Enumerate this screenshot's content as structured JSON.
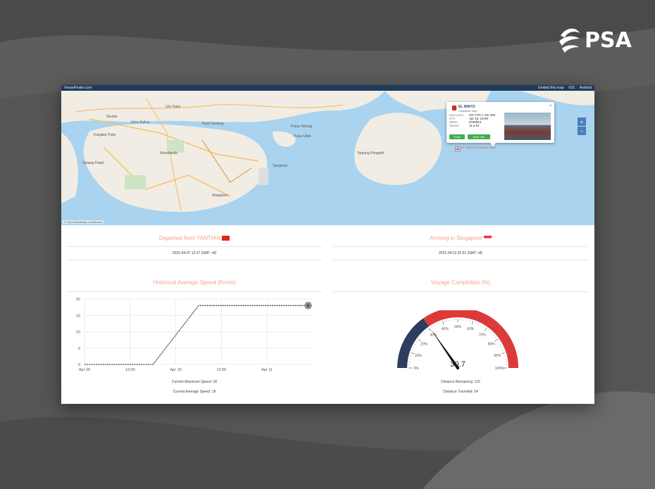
{
  "brand": {
    "logo_text": "PSA"
  },
  "site": {
    "name": "VesselFinder.com",
    "links": [
      "Embed this map",
      "iOS",
      "Android"
    ]
  },
  "map": {
    "labels": [
      {
        "text": "Johor Bahru",
        "kind": "city"
      },
      {
        "text": "Pulau Ubin",
        "kind": "city"
      },
      {
        "text": "Skudai",
        "kind": "city"
      },
      {
        "text": "Pulau Tekong",
        "kind": "city"
      },
      {
        "text": "Ulu Tiram",
        "kind": "city"
      },
      {
        "text": "Pasir Gudang",
        "kind": "city"
      },
      {
        "text": "Kangkar Pulai",
        "kind": "city"
      },
      {
        "text": "Woodlands",
        "kind": "city"
      },
      {
        "text": "Tampines",
        "kind": "city"
      },
      {
        "text": "Singapore",
        "kind": "city"
      },
      {
        "text": "Tanjung Pengelih",
        "kind": "city"
      },
      {
        "text": "Gelang Patah",
        "kind": "city"
      }
    ],
    "zoom_in": "+",
    "zoom_out": "−",
    "attribution": "© OpenStreetMap contributors"
  },
  "popup": {
    "vessel_name": "EL NINYO",
    "vessel_type": "Container Ship",
    "rows": [
      {
        "key": "Navi.point",
        "value": "CN YTN > SG SIN"
      },
      {
        "key": "ETA",
        "value": "Apr 10, 23:00"
      },
      {
        "key": "MMSI",
        "value": "9780913"
      },
      {
        "key": "Speed",
        "value": "11.2 kn"
      }
    ],
    "track_label": "Track",
    "more_info_label": "More info",
    "close": "×",
    "marker_caption": "EL NINYO (Container Ship)"
  },
  "departure": {
    "title": "Departed from YANTIAN",
    "time": "2021-04-07 12:17 (GMT +8)",
    "flag_color": "#de2910"
  },
  "arrival": {
    "title": "Arriving in Singapore",
    "time": "2021-04-11 01:51 (GMT +8)",
    "flag_color": "#ef3340"
  },
  "speed_section": {
    "title": "Historical Average Speed (Knots)",
    "max_speed": "Current Maximum Speed: 18",
    "avg_speed": "Current Average Speed: 18"
  },
  "voyage_section": {
    "title": "Voyage Completion (%)",
    "distance_remaining": "Distance Remaining: 122",
    "distance_travelled": "Distance Travelled: 54"
  },
  "chart_data": [
    {
      "type": "line",
      "title": "Historical Average Speed (Knots)",
      "xlabel": "",
      "ylabel": "",
      "x_ticks": [
        "Apr 09",
        "12:00",
        "Apr 10",
        "12:00",
        "Apr 11"
      ],
      "y_ticks": [
        "0",
        "5",
        "10",
        "15",
        "20"
      ],
      "ylim": [
        0,
        20
      ],
      "xlim": [
        0,
        2.5
      ],
      "series": [
        {
          "x": [
            0,
            0.25,
            0.5,
            0.75,
            1.0,
            1.25,
            1.5,
            1.75,
            2.0,
            2.25,
            2.45
          ],
          "y": [
            0,
            0,
            0,
            0,
            9,
            18,
            18,
            18,
            18,
            18,
            18
          ]
        }
      ],
      "grid": true,
      "line_color": "#444444",
      "last_marker_color": "#8a8a8a"
    },
    {
      "type": "gauge",
      "title": "Voyage Completion (%)",
      "value": 30.7,
      "value_label": "30.7",
      "min": 0,
      "max": 100,
      "tick_labels": [
        "0%",
        "10%",
        "20%",
        "30%",
        "40%",
        "50%",
        "60%",
        "70%",
        "80%",
        "90%",
        "100%"
      ],
      "completed_color": "#2e3c5e",
      "remaining_color": "#dc3a3a"
    }
  ]
}
